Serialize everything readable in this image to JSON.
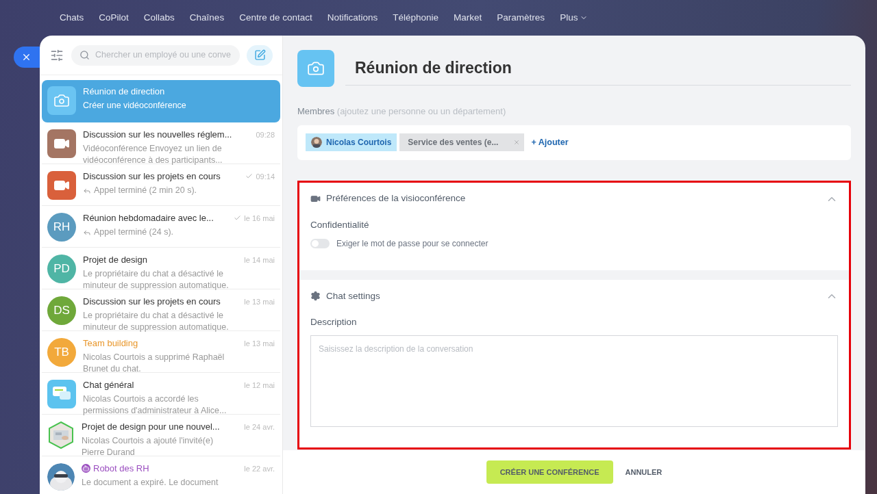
{
  "top_nav": [
    {
      "label": "Chats"
    },
    {
      "label": "CoPilot"
    },
    {
      "label": "Collabs"
    },
    {
      "label": "Chaînes"
    },
    {
      "label": "Centre de contact"
    },
    {
      "label": "Notifications"
    },
    {
      "label": "Téléphonie"
    },
    {
      "label": "Market"
    },
    {
      "label": "Paramètres"
    },
    {
      "label": "Plus",
      "dropdown": true
    }
  ],
  "search": {
    "placeholder": "Chercher un employé ou une conve"
  },
  "chats": [
    {
      "avatar": {
        "kind": "camera"
      },
      "title": "Réunion de direction",
      "preview": "Créer une vidéoconférence",
      "selected": true
    },
    {
      "avatar": {
        "kind": "video",
        "color": "#a47563"
      },
      "title": "Discussion sur les nouvelles réglem...",
      "time": "09:28",
      "preview": "Vidéoconférence Envoyez un lien de vidéoconférence à des participants...",
      "read": false,
      "selected": false
    },
    {
      "avatar": {
        "kind": "video",
        "color": "#d9603b"
      },
      "title": "Discussion sur les projets en cours",
      "time": "09:14",
      "preview": "Appel terminé (2 min 20 s).",
      "reply": true,
      "read": true,
      "selected": false
    },
    {
      "avatar": {
        "kind": "initials",
        "color": "#5b9bbf",
        "initials": "RH"
      },
      "title": "Réunion hebdomadaire avec le...",
      "time": "le 16 mai",
      "preview": "Appel terminé (24 s).",
      "reply": true,
      "read": true,
      "selected": false
    },
    {
      "avatar": {
        "kind": "initials",
        "color": "#4fb5a5",
        "initials": "PD"
      },
      "title": "Projet de design",
      "time": "le 14 mai",
      "preview": "Le propriétaire du chat a désactivé le minuteur de suppression automatique.",
      "read": false,
      "selected": false
    },
    {
      "avatar": {
        "kind": "initials",
        "color": "#6fa83a",
        "initials": "DS"
      },
      "title": "Discussion sur les projets en cours",
      "time": "le 13 mai",
      "preview": "Le propriétaire du chat a désactivé le minuteur de suppression automatique.",
      "read": false,
      "selected": false
    },
    {
      "avatar": {
        "kind": "initials",
        "color": "#f2a93b",
        "initials": "TB"
      },
      "title": "Team building",
      "color": "#e8962a",
      "time": "le 13 mai",
      "preview": "Nicolas Courtois a supprimé Raphaël Brunet du chat.",
      "read": false,
      "selected": false
    },
    {
      "avatar": {
        "kind": "chat"
      },
      "title": "Chat général",
      "time": "le 12 mai",
      "preview": "Nicolas Courtois a accordé les permissions d'administrateur à Alice...",
      "read": false,
      "selected": false
    },
    {
      "title": "Projet de design pour une nouvel...",
      "time": "le 24 avr.",
      "preview": "Nicolas Courtois a ajouté l'invité(e) Pierre Durand",
      "read": false,
      "selected": false
    },
    {
      "avatar": {
        "kind": "picture-round"
      },
      "title": "Robot des RH",
      "color": "#9b4fc0",
      "bot": true,
      "time": "le 22 avr.",
      "preview": "Le document a expiré. Le document",
      "read": false,
      "selected": false
    }
  ],
  "conference": {
    "title": "Réunion de direction",
    "members_label": "Membres",
    "members_hint": "(ajoutez une personne ou un département)",
    "members": [
      {
        "kind": "user",
        "name": "Nicolas Courtois"
      },
      {
        "kind": "department",
        "name": "Service des ventes (e..."
      }
    ],
    "add_label": "+ Ajouter"
  },
  "sections": [
    {
      "kind": "video",
      "title": "Préférences de la visioconférence",
      "expanded": true,
      "subtitle": "Confidentialité",
      "toggle": {
        "label": "Exiger le mot de passe pour se connecter",
        "on": false
      }
    },
    {
      "kind": "settings",
      "title": "Chat settings",
      "expanded": true,
      "subtitle": "Description",
      "field": {
        "placeholder": "Saisissez la description de la conversation"
      }
    }
  ],
  "buttons": [
    {
      "kind": "primary",
      "label": "CRÉER UNE CONFÉRENCE"
    },
    {
      "kind": "link",
      "label": "ANNULER"
    }
  ]
}
